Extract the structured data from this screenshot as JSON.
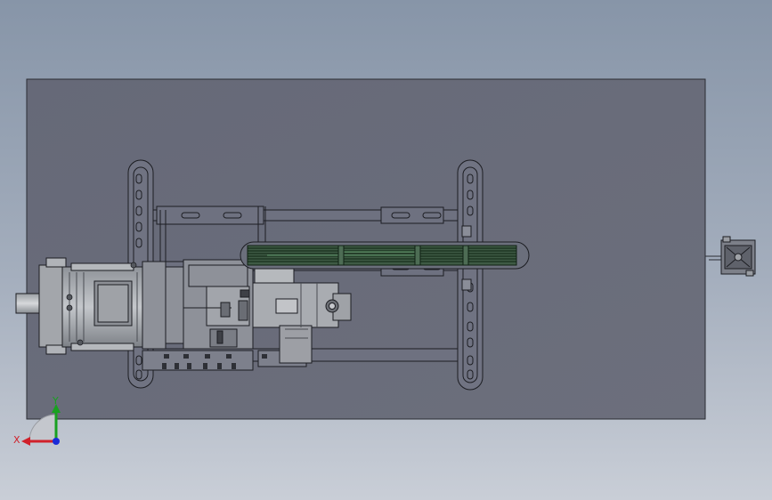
{
  "viewport": {
    "background_top": "#8795a8",
    "background_bottom": "#c9ced7",
    "plate_color": "#696c7a"
  },
  "triad": {
    "x_label": "X",
    "y_label": "Y",
    "x_color": "#d0202a",
    "y_color": "#18a020",
    "z_color": "#1a2bd8"
  },
  "icons": {
    "coordinate_triad": "coordinate-triad-icon"
  }
}
